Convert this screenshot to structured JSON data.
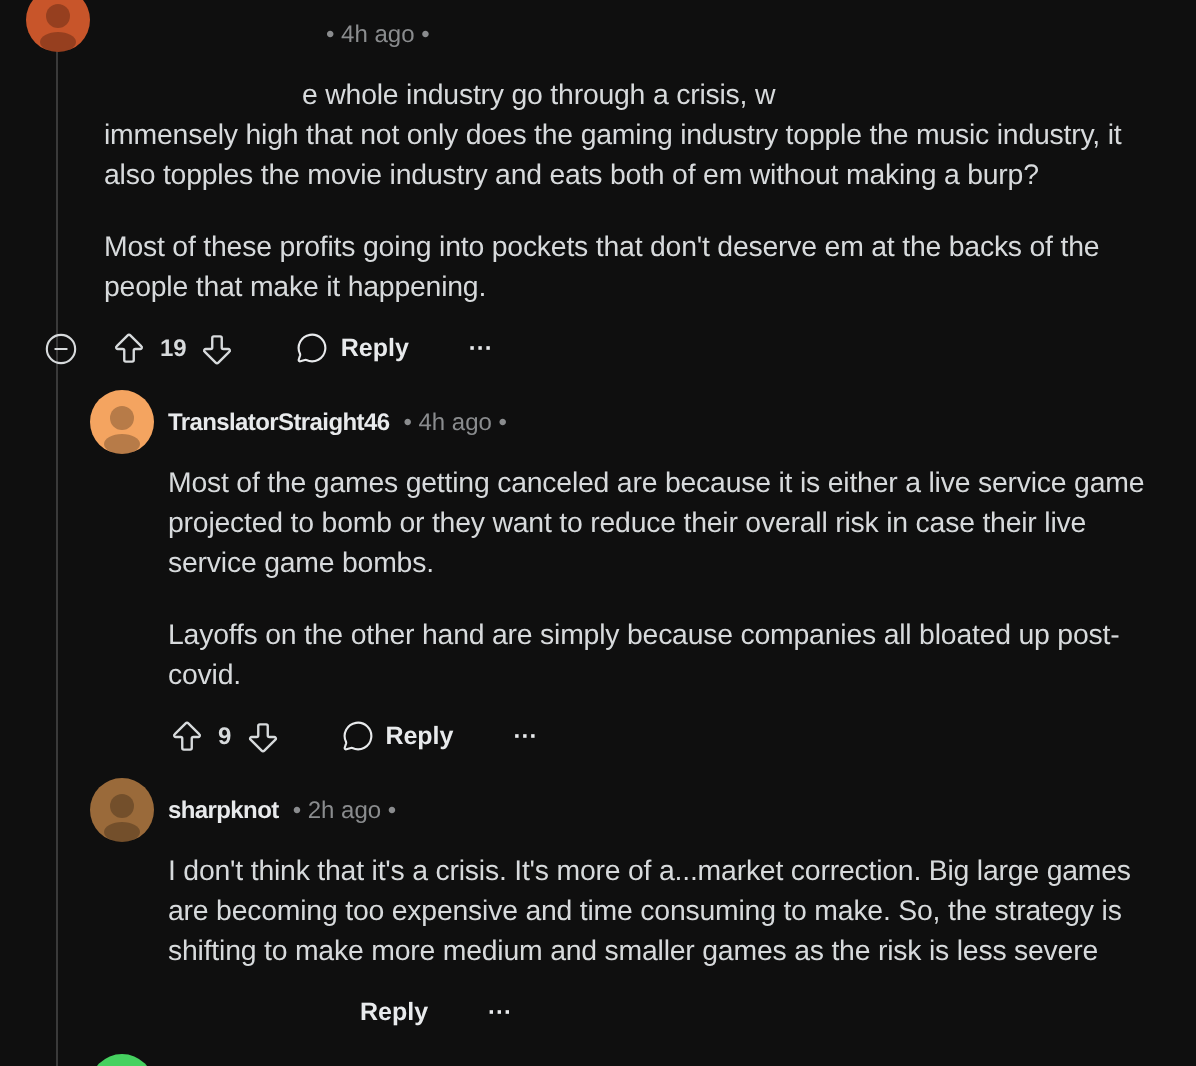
{
  "comments": [
    {
      "color": "#c8552a",
      "time": "• 4h ago •",
      "collapsible": true,
      "body": [
        [
          "e whole industry go through a crisis, w",
          "immensely high that not only does the gaming industry topple the music industry, it",
          "also topples the movie industry and eats both of em without making a burp?"
        ],
        [
          "Most of these profits going into pockets that don't deserve em at the backs of the",
          "people that make it happening."
        ]
      ],
      "score": "19",
      "reply": "Reply",
      "more": "···"
    },
    {
      "color": "#f4a460",
      "author": "TranslatorStraight46",
      "time": "• 4h ago •",
      "body": [
        [
          "Most of the games getting canceled are because it is either a live service game",
          "projected to bomb or they want to reduce their overall risk in case their live",
          "service game bombs."
        ],
        [
          "Layoffs on the other hand are simply because companies all bloated up post-",
          "covid."
        ]
      ],
      "score": "9",
      "reply": "Reply",
      "more": "···"
    },
    {
      "color": "#9a6a3a",
      "author": "sharpknot",
      "time": "• 2h ago •",
      "body": [
        [
          "I don't think that it's a crisis. It's more of a...market correction. Big large games",
          "are becoming too expensive and time consuming to make. So, the strategy is",
          "shifting to make more medium and smaller games as the risk is less severe"
        ]
      ],
      "reply": "Reply",
      "more": "···"
    },
    {
      "color": "#46d160"
    }
  ]
}
